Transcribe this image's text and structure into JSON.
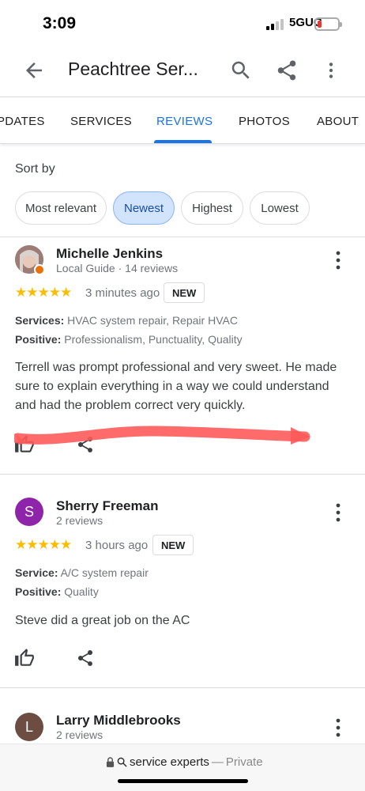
{
  "status": {
    "time": "3:09",
    "network": "5GUC"
  },
  "app_bar": {
    "title": "Peachtree Ser..."
  },
  "tabs": [
    {
      "label": "PDATES"
    },
    {
      "label": "SERVICES"
    },
    {
      "label": "REVIEWS"
    },
    {
      "label": "PHOTOS"
    },
    {
      "label": "ABOUT"
    }
  ],
  "sort": {
    "label": "Sort by",
    "options": [
      "Most relevant",
      "Newest",
      "Highest",
      "Lowest"
    ],
    "selected": "Newest"
  },
  "reviews": [
    {
      "name": "Michelle Jenkins",
      "subtitle": "Local Guide · 14 reviews",
      "stars": "★★★★★",
      "rating": 5,
      "time": "3 minutes ago",
      "badge": "NEW",
      "line1_label": "Services:",
      "line1_value": "HVAC system repair, Repair HVAC",
      "line2_label": "Positive:",
      "line2_value": "Professionalism, Punctuality, Quality",
      "text": "Terrell was prompt professional and very sweet. He made sure to explain everything in a way we could understand and had the problem correct very quickly."
    },
    {
      "name": "Sherry Freeman",
      "subtitle": "2 reviews",
      "initial": "S",
      "avatar_color": "#8e24aa",
      "stars": "★★★★★",
      "rating": 5,
      "time": "3 hours ago",
      "badge": "NEW",
      "line1_label": "Service:",
      "line1_value": "A/C system repair",
      "line2_label": "Positive:",
      "line2_value": "Quality",
      "text": "Steve did a great job on the AC"
    },
    {
      "name": "Larry Middlebrooks",
      "subtitle": "2 reviews",
      "initial": "L",
      "avatar_color": "#6d4c41"
    }
  ],
  "url_bar": {
    "query": "service experts",
    "separator": "—",
    "mode": "Private"
  },
  "colors": {
    "accent": "#1a73e8",
    "star": "#fbbc04",
    "annotation": "#ff4d4d"
  }
}
